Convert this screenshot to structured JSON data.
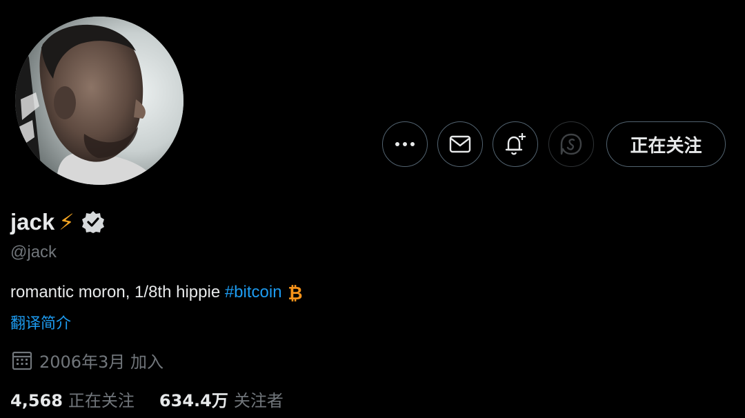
{
  "profile": {
    "display_name": "jack",
    "name_emoji": "⚡",
    "handle": "@jack",
    "bio_text": "romantic moron, 1/8th hippie ",
    "bio_hashtag": "#bitcoin",
    "translate_label": "翻译简介",
    "joined_text": "2006年3月 加入"
  },
  "stats": {
    "following_count": "4,568",
    "following_label": "正在关注",
    "followers_count": "634.4万",
    "followers_label": "关注者"
  },
  "actions": {
    "follow_state_label": "正在关注",
    "more_icon": "more-horizontal-icon",
    "message_icon": "envelope-icon",
    "notify_icon": "bell-plus-icon",
    "tip_icon": "tip-jar-icon"
  },
  "colors": {
    "background": "#000000",
    "text_primary": "#e7e9ea",
    "text_secondary": "#71767b",
    "link": "#1d9bf0",
    "bitcoin": "#f7931a",
    "button_border": "#536471"
  }
}
